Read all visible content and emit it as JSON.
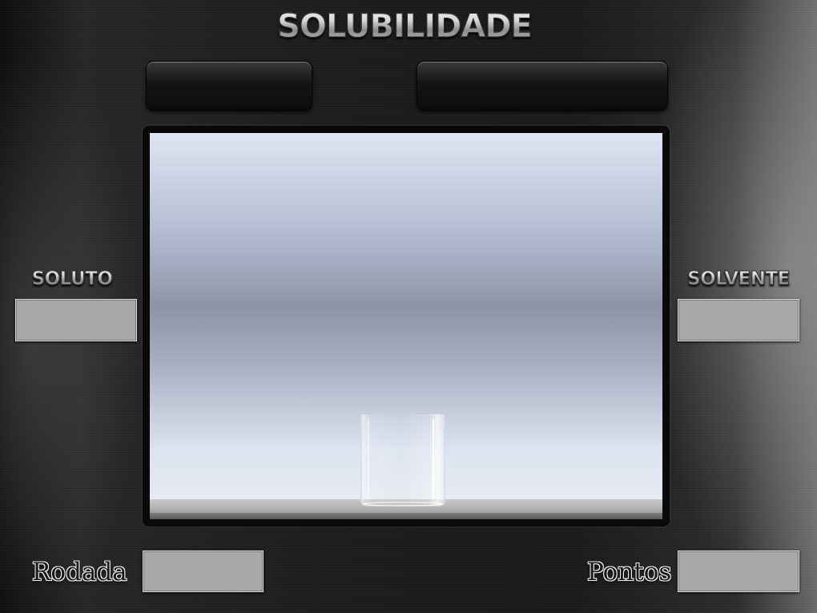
{
  "title": "SOLUBILIDADE",
  "panels": {
    "left_display": "",
    "right_display": ""
  },
  "soluto": {
    "label": "SOLUTO",
    "value": ""
  },
  "solvente": {
    "label": "SOLVENTE",
    "value": ""
  },
  "rodada": {
    "label": "Rodada",
    "value": ""
  },
  "pontos": {
    "label": "Pontos",
    "value": ""
  },
  "colors": {
    "background": "#1c1c1c",
    "stage_sky_top": "#dee6f4",
    "stage_sky_mid": "#8d94a8",
    "bench": "#b5b5b5",
    "box_gray": "#a8a8a8",
    "label_metal": "#bdbdbd"
  },
  "icons": {
    "beaker": "beaker-icon"
  }
}
